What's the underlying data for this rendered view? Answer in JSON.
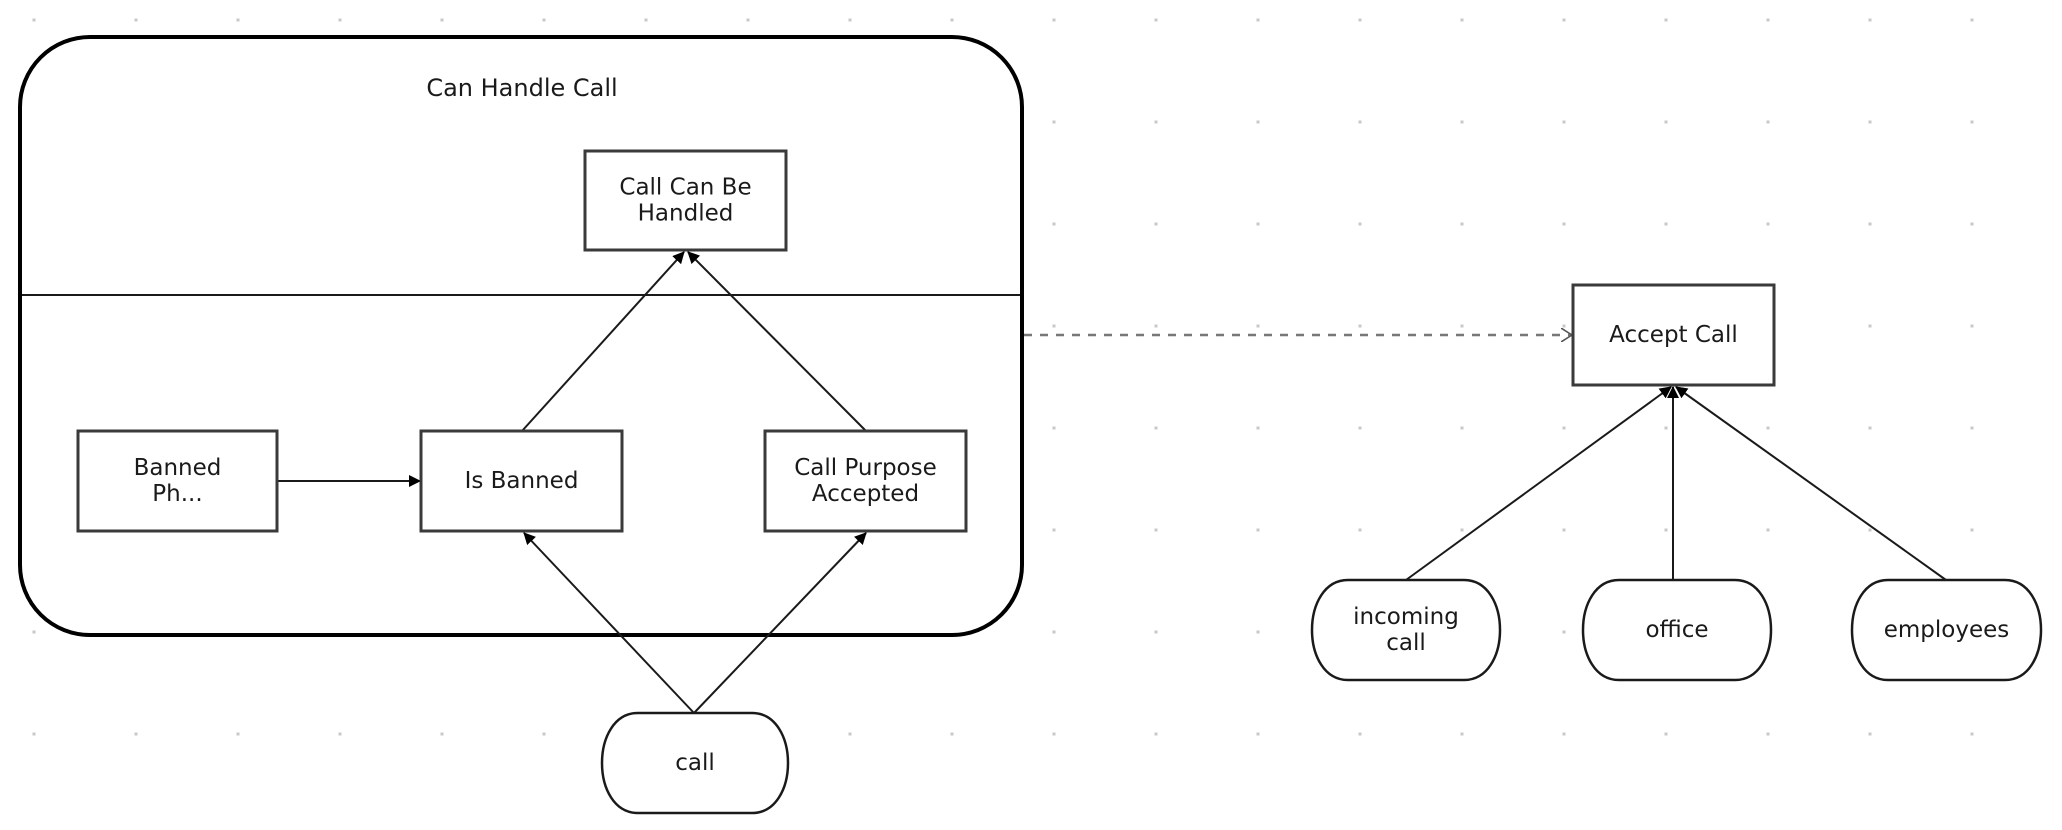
{
  "diagram": {
    "container": {
      "title": "Can Handle Call"
    },
    "nodes": [
      {
        "id": "call_can_be_handled",
        "shape": "rect",
        "lines": [
          "Call Can Be",
          "Handled"
        ]
      },
      {
        "id": "banned_ph",
        "shape": "rect",
        "lines": [
          "Banned",
          "Ph..."
        ]
      },
      {
        "id": "is_banned",
        "shape": "rect",
        "lines": [
          "Is Banned"
        ]
      },
      {
        "id": "call_purpose_accepted",
        "shape": "rect",
        "lines": [
          "Call Purpose",
          "Accepted"
        ]
      },
      {
        "id": "call",
        "shape": "stadium",
        "lines": [
          "call"
        ]
      },
      {
        "id": "accept_call",
        "shape": "rect",
        "lines": [
          "Accept Call"
        ]
      },
      {
        "id": "incoming_call",
        "shape": "stadium",
        "lines": [
          "incoming",
          "call"
        ]
      },
      {
        "id": "office",
        "shape": "stadium",
        "lines": [
          "office"
        ]
      },
      {
        "id": "employees",
        "shape": "stadium",
        "lines": [
          "employees"
        ]
      }
    ],
    "edges": [
      {
        "from": "is_banned",
        "to": "call_can_be_handled",
        "style": "solid"
      },
      {
        "from": "call_purpose_accepted",
        "to": "call_can_be_handled",
        "style": "solid"
      },
      {
        "from": "banned_ph",
        "to": "is_banned",
        "style": "solid"
      },
      {
        "from": "call",
        "to": "is_banned",
        "style": "solid"
      },
      {
        "from": "call",
        "to": "call_purpose_accepted",
        "style": "solid"
      },
      {
        "from": "incoming_call",
        "to": "accept_call",
        "style": "solid"
      },
      {
        "from": "office",
        "to": "accept_call",
        "style": "solid"
      },
      {
        "from": "employees",
        "to": "accept_call",
        "style": "solid"
      },
      {
        "from": "can_handle_call",
        "to": "accept_call",
        "style": "dashed"
      }
    ],
    "colors": {
      "stroke": "#1a1a1a",
      "box_stroke": "#3a3a3a",
      "dashed": "#777777",
      "grid_dot": "#c8c8c8"
    }
  }
}
